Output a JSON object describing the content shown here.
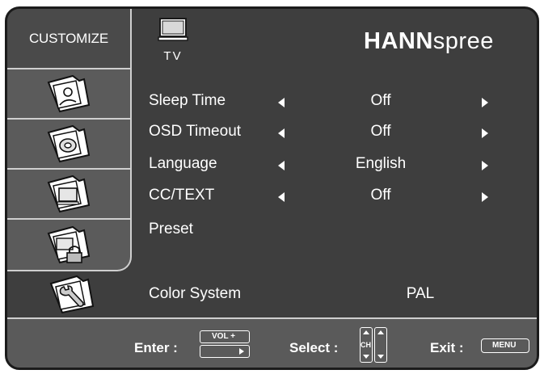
{
  "header": {
    "title": "CUSTOMIZE",
    "source_label": "TV",
    "brand_bold": "HANN",
    "brand_light": "spree"
  },
  "sidebar": {
    "items": [
      {
        "icon": "user-photo-icon"
      },
      {
        "icon": "audio-disc-icon"
      },
      {
        "icon": "screen-display-icon"
      },
      {
        "icon": "parental-lock-icon"
      }
    ],
    "active_item": {
      "icon": "tools-wrench-icon"
    }
  },
  "menu": {
    "rows": [
      {
        "label": "Sleep Time",
        "value": "Off"
      },
      {
        "label": "OSD Timeout",
        "value": "Off"
      },
      {
        "label": "Language",
        "value": "English"
      },
      {
        "label": "CC/TEXT",
        "value": "Off"
      }
    ],
    "preset_label": "Preset",
    "color_system_label": "Color System",
    "color_system_value": "PAL"
  },
  "footer": {
    "enter_label": "Enter :",
    "vol_key": "VOL +",
    "select_label": "Select :",
    "ch_key": "CH",
    "exit_label": "Exit :",
    "menu_key": "MENU"
  },
  "colors": {
    "panel": "#3e3e3e",
    "sidebar": "#5b5b5b",
    "footer": "#5a5a5a",
    "border": "#cfcfcf",
    "text": "#ffffff"
  }
}
